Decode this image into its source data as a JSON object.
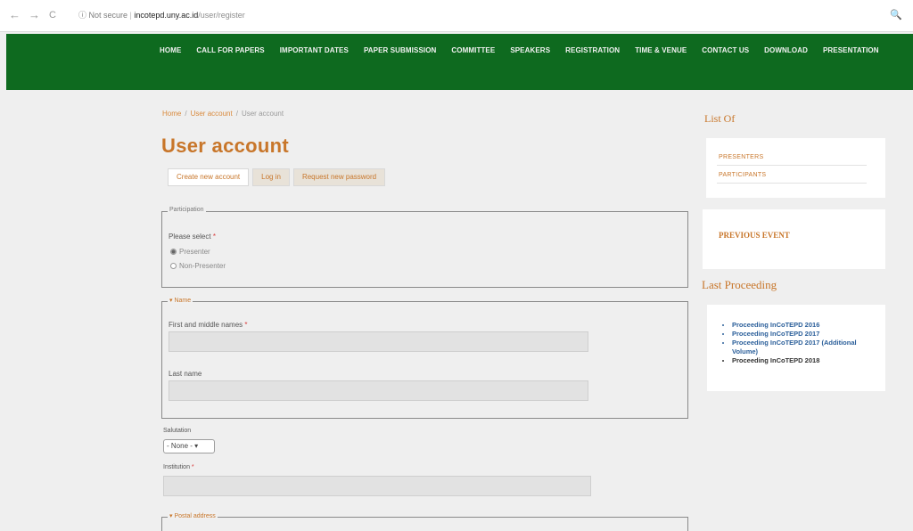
{
  "browser": {
    "back": "←",
    "forward": "→",
    "reload": "C",
    "security": "ⓘ Not secure",
    "domain": "incotepd.uny.ac.id",
    "path": "/user/register",
    "zoom": "🔍"
  },
  "menu": [
    "HOME",
    "CALL FOR PAPERS",
    "IMPORTANT DATES",
    "PAPER SUBMISSION",
    "COMMITTEE",
    "SPEAKERS",
    "REGISTRATION",
    "TIME & VENUE",
    "CONTACT US",
    "DOWNLOAD",
    "PRESENTATION"
  ],
  "breadcrumb": [
    "Home",
    "User account",
    "User account"
  ],
  "page_title": "User account",
  "tabs": [
    "Create new account",
    "Log in",
    "Request new password"
  ],
  "participation": {
    "legend": "Participation",
    "question": "Please select",
    "required": "*",
    "options": [
      "Presenter",
      "Non-Presenter"
    ]
  },
  "name": {
    "legend": "▾ Name",
    "first_label": "First and middle names",
    "last_label": "Last name",
    "required": "*"
  },
  "salutation": {
    "label": "Salutation",
    "value": "- None - ▾"
  },
  "institution": {
    "label": "Institution",
    "required": "*"
  },
  "postal": {
    "legend": "▾ Postal address"
  },
  "sidebar": {
    "list_heading": "List Of",
    "list_items": [
      "PRESENTERS",
      "PARTICIPANTS"
    ],
    "previous_event": "PREVIOUS EVENT",
    "proc_heading": "Last Proceeding",
    "proceedings": [
      "Proceeding InCoTEPD 2016",
      "Proceeding InCoTEPD 2017",
      "Proceeding InCoTEPD 2017 (Additional Volume)",
      "Proceeding InCoTEPD 2018"
    ]
  },
  "colors": {
    "header_green": "#0e6a1f",
    "accent_orange": "#c8762a",
    "link_blue": "#2b5f9a"
  }
}
